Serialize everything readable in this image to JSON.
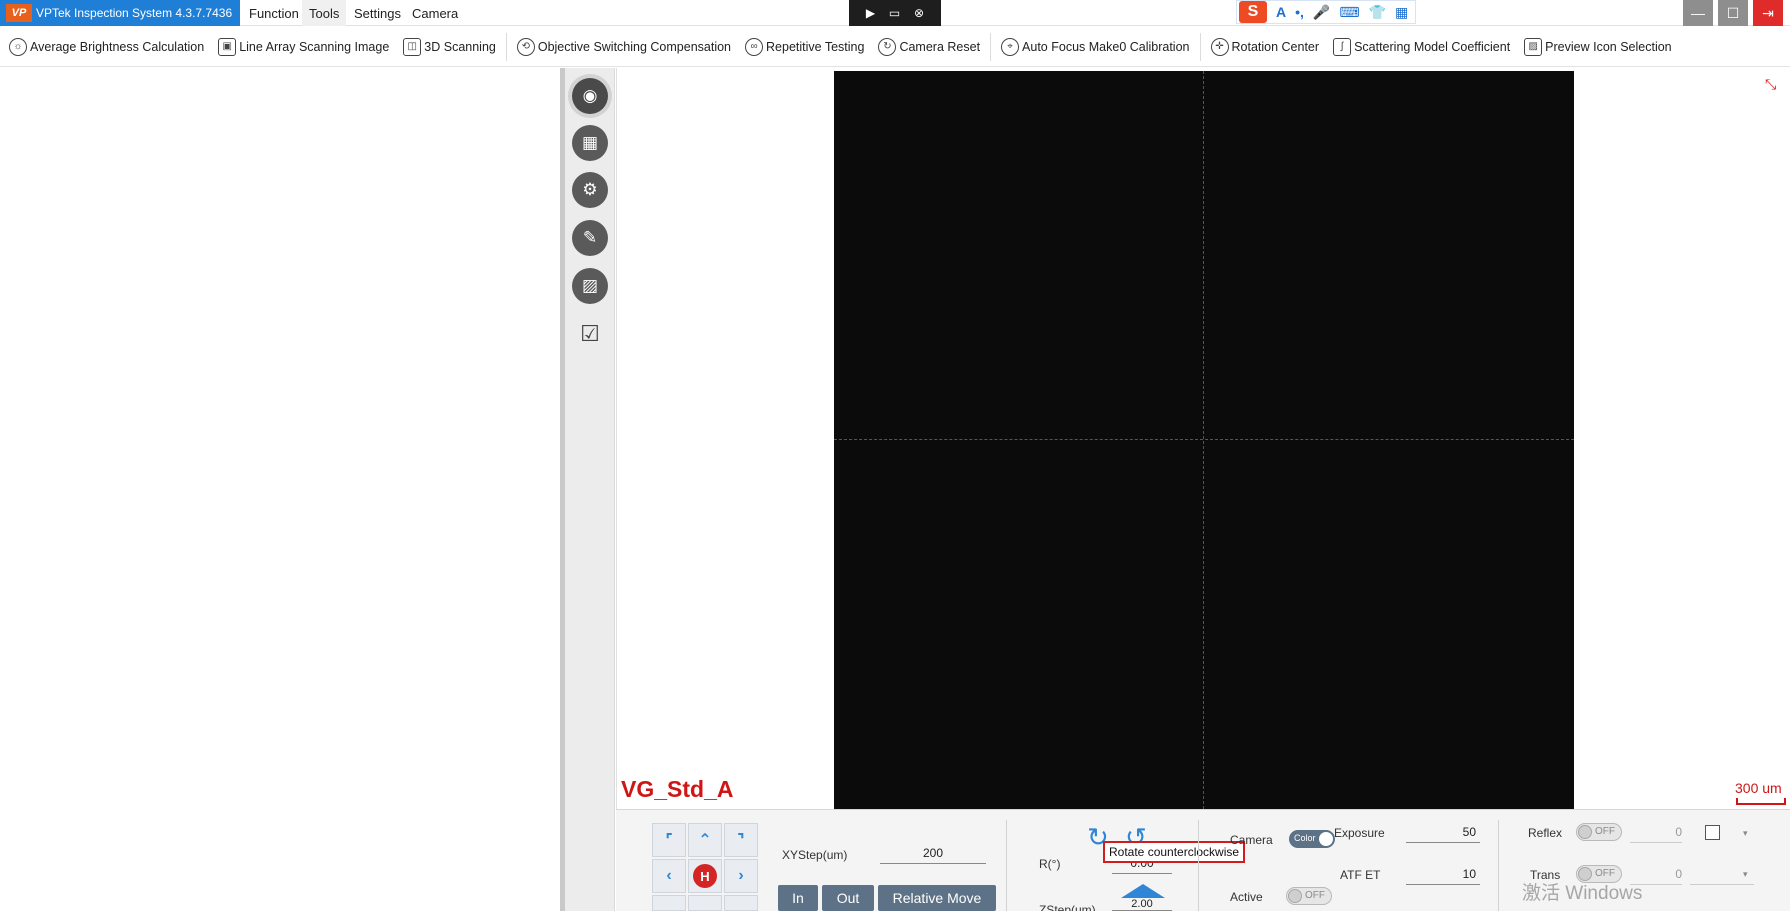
{
  "window": {
    "logo_text": "VP",
    "title": "VPTek Inspection System 4.3.7.7436",
    "menu": [
      {
        "label": "Function",
        "active": false
      },
      {
        "label": "Tools",
        "active": true
      },
      {
        "label": "Settings",
        "active": false
      },
      {
        "label": "Camera",
        "active": false
      }
    ],
    "media_controls": [
      "play-icon",
      "screen-icon",
      "close-circle-icon"
    ],
    "ime_logo": "S",
    "ime_icons": [
      "A",
      "•,",
      "🎤",
      "⌨",
      "👕",
      "▦"
    ],
    "win_buttons": {
      "minimize": "—",
      "maximize": "☐",
      "exit": "⇥"
    },
    "colors": {
      "title_bg": "#1f7ed6",
      "accent_red": "#d01515",
      "jog_blue": "#2f86d6",
      "button_dark": "#5d7187"
    }
  },
  "toolbar": [
    {
      "label": "Average Brightness Calculation",
      "icon": "bulb-icon",
      "glyph": "☼"
    },
    {
      "label": "Line Array Scanning Image",
      "icon": "scan-frame-icon",
      "glyph": "▣"
    },
    {
      "label": "3D Scanning",
      "icon": "3d-scan-icon",
      "glyph": "◫"
    },
    {
      "label": "Objective Switching Compensation",
      "icon": "objective-icon",
      "glyph": "⟲"
    },
    {
      "label": "Repetitive Testing",
      "icon": "repeat-icon",
      "glyph": "∞"
    },
    {
      "label": "Camera Reset",
      "icon": "reset-icon",
      "glyph": "↻"
    },
    {
      "label": "Auto Focus Make0 Calibration",
      "icon": "crosshair-icon",
      "glyph": "⌖"
    },
    {
      "label": "Rotation Center",
      "icon": "rotation-center-icon",
      "glyph": "✛"
    },
    {
      "label": "Scattering Model Coefficient",
      "icon": "curve-icon",
      "glyph": "∫"
    },
    {
      "label": "Preview Icon Selection",
      "icon": "image-preview-icon",
      "glyph": "▨"
    }
  ],
  "side_rail": [
    {
      "icon": "camera-icon",
      "glyph": "◉",
      "selected": true
    },
    {
      "icon": "grid-sphere-icon",
      "glyph": "▦",
      "selected": false
    },
    {
      "icon": "settings-list-icon",
      "glyph": "⚙",
      "selected": false
    },
    {
      "icon": "ruler-icon",
      "glyph": "✎",
      "selected": false
    },
    {
      "icon": "image-icon",
      "glyph": "▨",
      "selected": false
    },
    {
      "icon": "checklist-icon",
      "glyph": "☑",
      "selected": false
    }
  ],
  "viewer": {
    "recipe_name": "VG_Std_A",
    "scale_label": "300 um",
    "collapse_glyph": "⤡"
  },
  "controls": {
    "jog": {
      "up_left": "⌜",
      "up": "⌃",
      "up_right": "⌝",
      "left": "‹",
      "home": "H",
      "right": "›"
    },
    "xystep_label": "XYStep(um)",
    "xystep_value": "200",
    "buttons": {
      "in": "In",
      "out": "Out",
      "relative_move": "Relative Move"
    },
    "r_label": "R(°)",
    "r_value": "0.00",
    "rotate_cw_glyph": "↻",
    "rotate_ccw_glyph": "↺",
    "tooltip": "Rotate counterclockwise",
    "zstep_label": "ZStep(um)",
    "zstep_value": "2.00",
    "camera_label": "Camera",
    "camera_toggle": "Color",
    "active_label": "Active",
    "active_toggle": "OFF",
    "exposure_label": "Exposure",
    "exposure_value": "50",
    "atf_label": "ATF ET",
    "atf_value": "10",
    "reflex_label": "Reflex",
    "reflex_toggle": "OFF",
    "reflex_value": "0",
    "trans_label": "Trans",
    "trans_toggle": "OFF",
    "trans_value": "0",
    "dropdown_glyph": "▾"
  },
  "watermark": "激活 Windows"
}
